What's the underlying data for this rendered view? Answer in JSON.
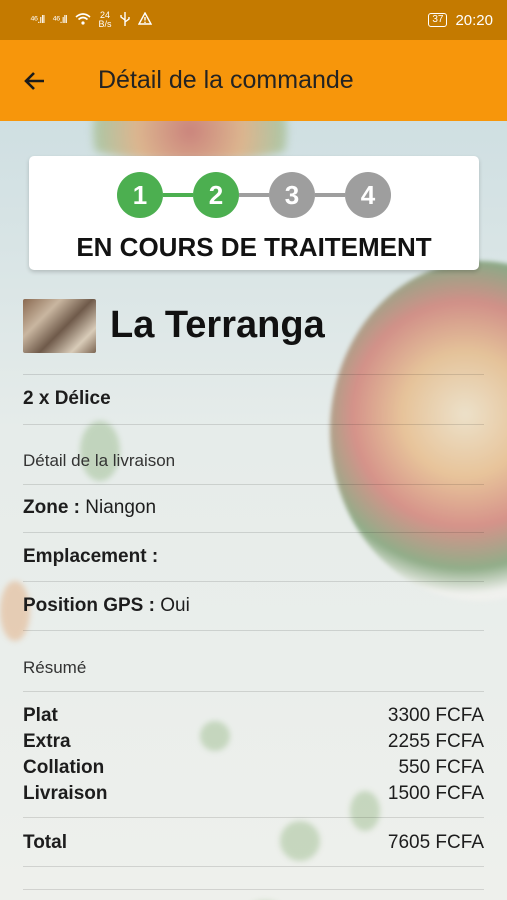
{
  "statusbar": {
    "signal1": "⁴⁶.ıll",
    "signal2": "⁴⁶.ıll",
    "speed_value": "24",
    "speed_unit": "B/s",
    "battery": "37",
    "time": "20:20"
  },
  "appbar": {
    "title": "Détail de la commande"
  },
  "progress": {
    "steps": [
      {
        "label": "1",
        "state": "done"
      },
      {
        "label": "2",
        "state": "done"
      },
      {
        "label": "3",
        "state": "todo"
      },
      {
        "label": "4",
        "state": "todo"
      }
    ],
    "status": "EN COURS DE TRAITEMENT",
    "colors": {
      "done": "#4caf50",
      "todo": "#9e9e9e"
    }
  },
  "restaurant": {
    "name": "La Terranga"
  },
  "order": {
    "item": "2 x Délice"
  },
  "delivery": {
    "section_title": "Détail de la livraison",
    "zone_label": "Zone :",
    "zone_value": "Niangon",
    "location_label": "Emplacement :",
    "location_value": "",
    "gps_label": "Position GPS :",
    "gps_value": "Oui"
  },
  "summary": {
    "section_title": "Résumé",
    "rows": [
      {
        "label": "Plat",
        "value": "3300 FCFA"
      },
      {
        "label": "Extra",
        "value": "2255 FCFA"
      },
      {
        "label": "Collation",
        "value": "550 FCFA"
      },
      {
        "label": "Livraison",
        "value": "1500 FCFA"
      }
    ],
    "total_label": "Total",
    "total_value": "7605 FCFA"
  },
  "colors": {
    "appbar": "#f7960b",
    "statusbar": "#c47a00"
  }
}
